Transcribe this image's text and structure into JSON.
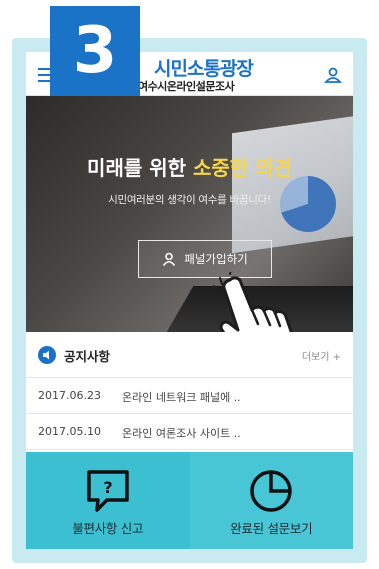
{
  "step_badge": "3",
  "header": {
    "title": "시민소통광장",
    "subtitle": "여수시온라인설문조사",
    "menu_icon": "hamburger-menu-icon",
    "user_icon": "user-icon"
  },
  "hero": {
    "headline_plain": "미래를 위한 ",
    "headline_accent": "소중한 의견",
    "subtext": "시민여러분의 생각이 여수를 바꿉니다!",
    "join_button_label": "패널가입하기",
    "join_icon": "person-icon"
  },
  "notice": {
    "title": "공지사항",
    "more_label": "더보기 +",
    "items": [
      {
        "date": "2017.06.23",
        "title": "온라인 네트워크 패널에 .."
      },
      {
        "date": "2017.05.10",
        "title": "온라인 여론조사 사이트 .."
      }
    ]
  },
  "tiles": [
    {
      "label": "불편사항 신고",
      "icon": "report-speech-bubble-icon"
    },
    {
      "label": "완료된 설문보기",
      "icon": "pie-chart-icon"
    }
  ],
  "colors": {
    "brand_blue": "#1b73c7",
    "accent_yellow": "#f5d64a",
    "tile_teal": "#3cc0d1",
    "frame_bg": "#c9eaf1"
  }
}
